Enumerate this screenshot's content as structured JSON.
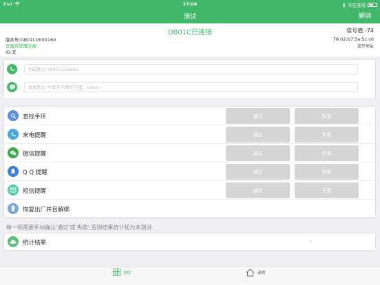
{
  "status_bar": {
    "device": "iPad",
    "time": "17:04",
    "charging": "不在充电",
    "icons": [
      "wifi-icon",
      "bluetooth-icon",
      "battery-icon"
    ]
  },
  "nav": {
    "title": "测试",
    "action": "解绑"
  },
  "device": {
    "status": "DB01C已连接",
    "version": "版本号:DB01CV000160",
    "reminder": "设备有提醒功能",
    "id": "ID:无",
    "signal": "信号值:-74",
    "bt_address": "78:02:b7:5a:5c:c6",
    "bt_label": "蓝牙地址"
  },
  "messages": {
    "phone_placeholder": "号码默认:18855556666",
    "msg_placeholder": "消息默认:今早天气晴空万里。haha !"
  },
  "tests": [
    {
      "label": "查找手环",
      "icon": "search-icon",
      "color": "#5b8fd6"
    },
    {
      "label": "来电提醒",
      "icon": "phone-icon",
      "color": "#49a6e0"
    },
    {
      "label": "微信提醒",
      "icon": "wechat-icon",
      "color": "#3aad4a"
    },
    {
      "label": "Q Q 提醒",
      "icon": "qq-icon",
      "color": "#3b7fe0"
    },
    {
      "label": "短信提醒",
      "icon": "sms-icon",
      "color": "#4ecba8"
    }
  ],
  "buttons": {
    "pass": "通过",
    "fail": "失败"
  },
  "reset": {
    "label": "恢复出厂并且解绑",
    "icon": "trash-icon",
    "color": "#7aa6d9"
  },
  "hint": "每一项需要手动确认'通过'或'失败',否则结果统计视为未测试",
  "result": {
    "label": "统计结果",
    "icon": "cloud-icon",
    "color": "#5ec07a"
  },
  "tabs": [
    {
      "label": "测试",
      "icon": "grid-icon"
    },
    {
      "label": "说明",
      "icon": "home-icon"
    }
  ],
  "colors": {
    "brand": "#41b86a",
    "button_disabled": "#d5d5d5",
    "background": "#efeff4"
  }
}
